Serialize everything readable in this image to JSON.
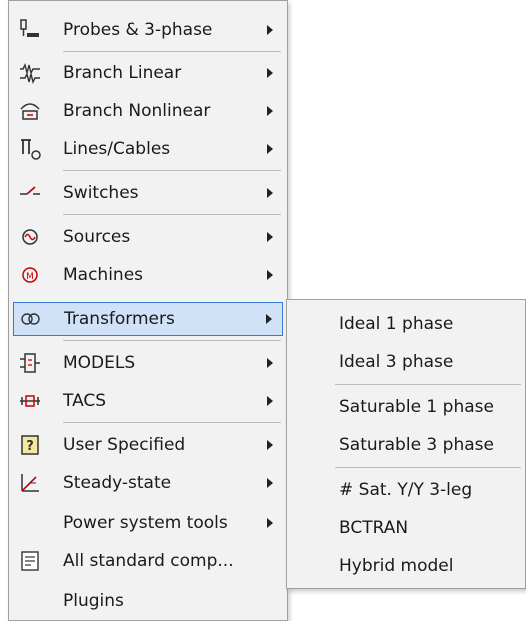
{
  "main_menu": {
    "items": [
      {
        "label": "Probes & 3-phase",
        "icon": "probe-icon",
        "submenu": true
      },
      {
        "label": "Branch Linear",
        "icon": "branch-linear-icon",
        "submenu": true
      },
      {
        "label": "Branch Nonlinear",
        "icon": "branch-nonlinear-icon",
        "submenu": true
      },
      {
        "label": "Lines/Cables",
        "icon": "lines-cables-icon",
        "submenu": true
      },
      {
        "label": "Switches",
        "icon": "switch-icon",
        "submenu": true
      },
      {
        "label": "Sources",
        "icon": "source-icon",
        "submenu": true
      },
      {
        "label": "Machines",
        "icon": "machine-icon",
        "submenu": true
      },
      {
        "label": "Transformers",
        "icon": "transformer-icon",
        "submenu": true,
        "active": true
      },
      {
        "label": "MODELS",
        "icon": "models-icon",
        "submenu": true
      },
      {
        "label": "TACS",
        "icon": "tacs-icon",
        "submenu": true
      },
      {
        "label": "User Specified",
        "icon": "user-specified-icon",
        "submenu": true
      },
      {
        "label": "Steady-state",
        "icon": "steady-state-icon",
        "submenu": true
      },
      {
        "label": "Power system tools",
        "icon": "",
        "submenu": true
      },
      {
        "label": "All standard comp...",
        "icon": "document-icon",
        "submenu": false
      },
      {
        "label": "Plugins",
        "icon": "",
        "submenu": false
      }
    ]
  },
  "transformers_submenu": {
    "items": [
      {
        "label": "Ideal 1 phase"
      },
      {
        "label": "Ideal 3 phase"
      },
      {
        "label": "Saturable 1 phase"
      },
      {
        "label": "Saturable 3 phase"
      },
      {
        "label": "# Sat. Y/Y 3-leg"
      },
      {
        "label": "BCTRAN"
      },
      {
        "label": "Hybrid model"
      }
    ]
  },
  "colors": {
    "menu_bg": "#f2f2f2",
    "highlight_bg": "#cfe2f8",
    "highlight_border": "#3a78d6"
  }
}
